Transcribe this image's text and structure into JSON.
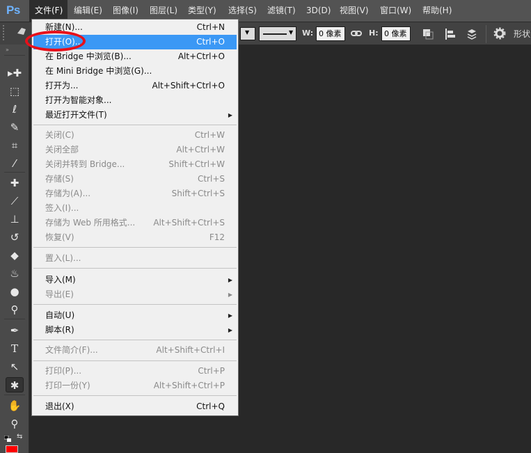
{
  "app": {
    "logo": "Ps"
  },
  "menubar": {
    "items": [
      "文件(F)",
      "编辑(E)",
      "图像(I)",
      "图层(L)",
      "类型(Y)",
      "选择(S)",
      "滤镜(T)",
      "3D(D)",
      "视图(V)",
      "窗口(W)",
      "帮助(H)"
    ]
  },
  "options": {
    "w_label": "W:",
    "w_value": "0 像素",
    "h_label": "H:",
    "h_value": "0 像素",
    "shape_label": "形状"
  },
  "file_menu": {
    "items": [
      {
        "label": "新建(N)...",
        "shortcut": "Ctrl+N"
      },
      {
        "label": "打开(O)...",
        "shortcut": "Ctrl+O"
      },
      {
        "label": "在 Bridge 中浏览(B)...",
        "shortcut": "Alt+Ctrl+O"
      },
      {
        "label": "在 Mini Bridge 中浏览(G)...",
        "shortcut": ""
      },
      {
        "label": "打开为...",
        "shortcut": "Alt+Shift+Ctrl+O"
      },
      {
        "label": "打开为智能对象...",
        "shortcut": ""
      },
      {
        "label": "最近打开文件(T)",
        "shortcut": ""
      },
      {
        "label": "关闭(C)",
        "shortcut": "Ctrl+W"
      },
      {
        "label": "关闭全部",
        "shortcut": "Alt+Ctrl+W"
      },
      {
        "label": "关闭并转到 Bridge...",
        "shortcut": "Shift+Ctrl+W"
      },
      {
        "label": "存储(S)",
        "shortcut": "Ctrl+S"
      },
      {
        "label": "存储为(A)...",
        "shortcut": "Shift+Ctrl+S"
      },
      {
        "label": "签入(I)...",
        "shortcut": ""
      },
      {
        "label": "存储为 Web 所用格式...",
        "shortcut": "Alt+Shift+Ctrl+S"
      },
      {
        "label": "恢复(V)",
        "shortcut": "F12"
      },
      {
        "label": "置入(L)...",
        "shortcut": ""
      },
      {
        "label": "导入(M)",
        "shortcut": ""
      },
      {
        "label": "导出(E)",
        "shortcut": ""
      },
      {
        "label": "自动(U)",
        "shortcut": ""
      },
      {
        "label": "脚本(R)",
        "shortcut": ""
      },
      {
        "label": "文件简介(F)...",
        "shortcut": "Alt+Shift+Ctrl+I"
      },
      {
        "label": "打印(P)...",
        "shortcut": "Ctrl+P"
      },
      {
        "label": "打印一份(Y)",
        "shortcut": "Alt+Shift+Ctrl+P"
      },
      {
        "label": "退出(X)",
        "shortcut": "Ctrl+Q"
      }
    ]
  },
  "colors": {
    "foreground": "#ff0000",
    "highlight": "#3b98f5",
    "annotation": "#e8101a"
  },
  "icons": [
    "move-tool-icon",
    "marquee-tool-icon",
    "lasso-tool-icon",
    "quick-select-tool-icon",
    "crop-tool-icon",
    "eyedropper-tool-icon",
    "healing-brush-tool-icon",
    "brush-tool-icon",
    "clone-stamp-tool-icon",
    "history-brush-tool-icon",
    "eraser-tool-icon",
    "paint-bucket-tool-icon",
    "blur-tool-icon",
    "dodge-tool-icon",
    "pen-tool-icon",
    "type-tool-icon",
    "path-selection-tool-icon",
    "custom-shape-tool-icon",
    "hand-tool-icon",
    "zoom-tool-icon"
  ]
}
